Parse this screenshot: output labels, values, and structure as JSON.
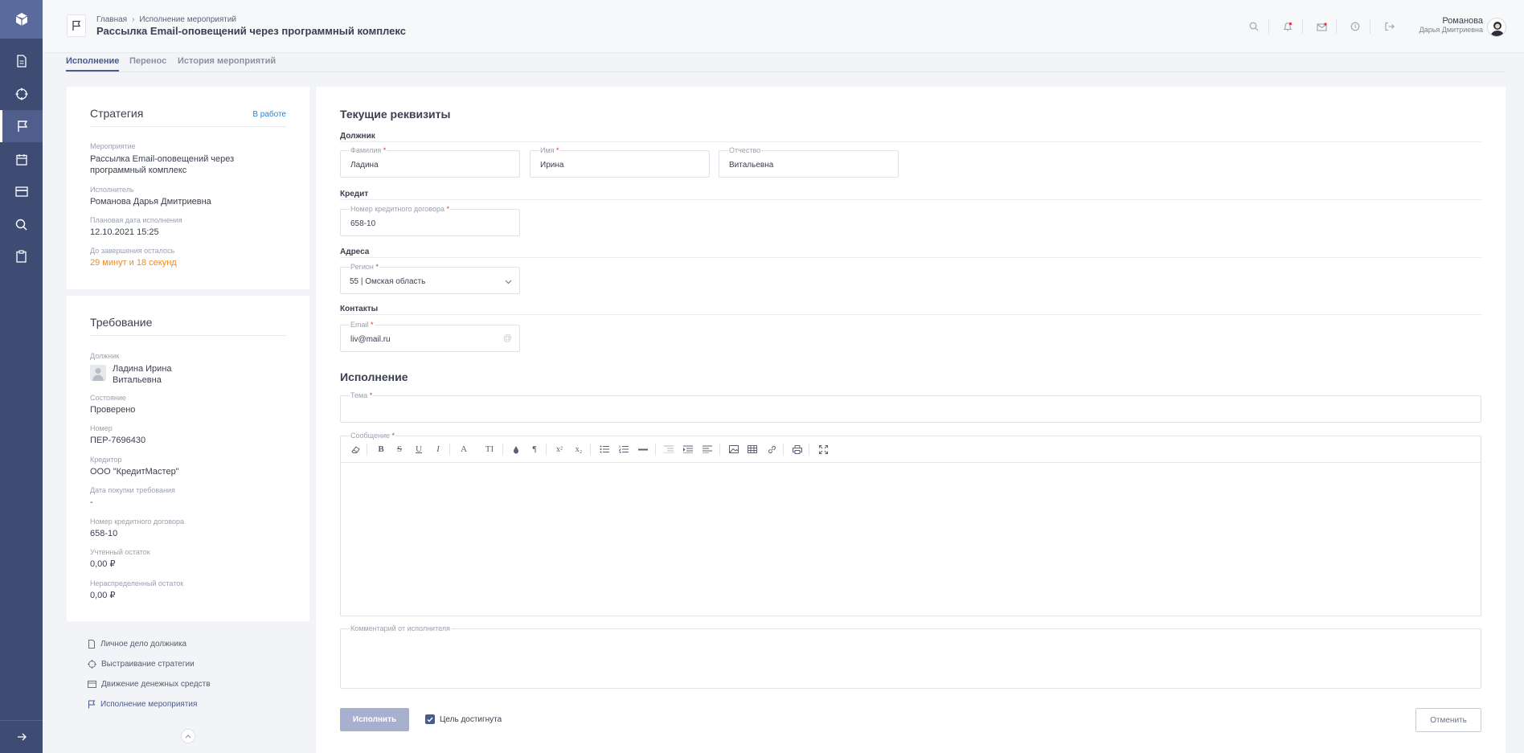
{
  "header": {
    "breadcrumbs": [
      "Главная",
      "Исполнение мероприятий"
    ],
    "title": "Рассылка Email-оповещений через программный комплекс",
    "user_name": "Романова",
    "user_sub": "Дарья Дмитриевна"
  },
  "tabs": [
    {
      "label": "Исполнение",
      "active": true
    },
    {
      "label": "Перенос",
      "active": false
    },
    {
      "label": "История мероприятий",
      "active": false
    }
  ],
  "strategy": {
    "title": "Стратегия",
    "status": "В работе",
    "event_label": "Мероприятие",
    "event_value_line1": "Рассылка Email-оповещений через",
    "event_value_line2": "программный комплекс",
    "executor_label": "Исполнитель",
    "executor_value": "Романова Дарья Дмитриевна",
    "planned_date_label": "Плановая дата исполнения",
    "planned_date_value": "12.10.2021 15:25",
    "remaining_label": "До завершения осталось",
    "remaining_value": "29 минут и 18 секунд"
  },
  "requirement": {
    "title": "Требование",
    "debtor_label": "Должник",
    "debtor_line1": "Ладина Ирина",
    "debtor_line2": "Витальевна",
    "state_label": "Состояние",
    "state_value": "Проверено",
    "number_label": "Номер",
    "number_value": "ПЕР-7696430",
    "creditor_label": "Кредитор",
    "creditor_value": "ООО \"КредитМастер\"",
    "purchase_date_label": "Дата покупки требования",
    "purchase_date_value": "-",
    "contract_label": "Номер кредитного договора",
    "contract_value": "658-10",
    "accounted_label": "Учтенный остаток",
    "accounted_value": "0,00 ₽",
    "undistributed_label": "Нераспределенный остаток",
    "undistributed_value": "0,00 ₽"
  },
  "links": [
    {
      "label": "Личное дело должника",
      "active": false
    },
    {
      "label": "Выстраивание стратегии",
      "active": false
    },
    {
      "label": "Движение денежных средств",
      "active": false
    },
    {
      "label": "Исполнение мероприятия",
      "active": true
    }
  ],
  "main": {
    "current_title": "Текущие реквизиты",
    "debtor_section": "Должник",
    "surname_label": "Фамилия",
    "surname_value": "Ладина",
    "name_label": "Имя",
    "name_value": "Ирина",
    "patronymic_label": "Отчество",
    "patronymic_value": "Витальевна",
    "credit_section": "Кредит",
    "contract_label": "Номер кредитного договора",
    "contract_value": "658-10",
    "address_section": "Адреса",
    "region_label": "Регион",
    "region_value": "55 | Омская область",
    "contacts_section": "Контакты",
    "email_label": "Email",
    "email_value": "liv@mail.ru",
    "execution_title": "Исполнение",
    "subject_label": "Тема",
    "message_label": "Сообщение",
    "comment_label": "Комментарий от исполнителя",
    "execute_button": "Исполнить",
    "goal_checkbox": "Цель достигнута",
    "cancel_button": "Отменить",
    "required_mark": "*"
  },
  "colors": {
    "rail": "#3e4b73",
    "accent": "#4a5a8e",
    "status_blue": "#2f7fd0",
    "remaining_orange": "#f08a1c",
    "required_red": "#e0314c"
  }
}
